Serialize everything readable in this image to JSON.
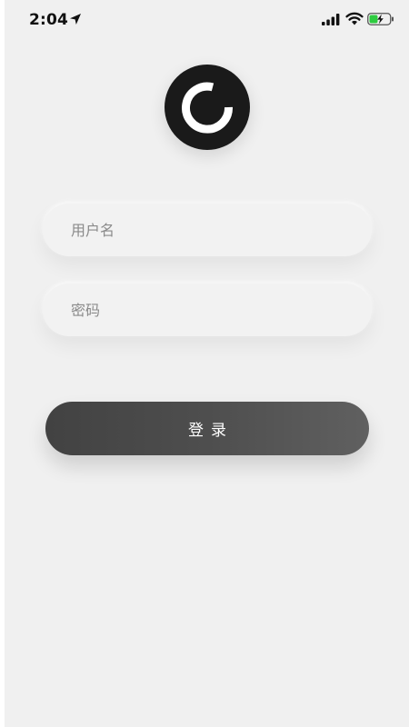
{
  "status_bar": {
    "time": "2:04",
    "icons": [
      "location-arrow-icon",
      "signal-icon",
      "wifi-icon",
      "battery-charging-icon"
    ],
    "battery_color": "#2ecc40"
  },
  "logo": {
    "icon": "logo-ring-icon",
    "background_color": "#1a1a1a",
    "ring_color": "#ffffff"
  },
  "form": {
    "username_placeholder": "用户名",
    "username_value": "",
    "password_placeholder": "密码",
    "password_value": ""
  },
  "login_button": {
    "label": "登录",
    "gradient_start": "#424242",
    "gradient_end": "#606060"
  },
  "background_color": "#f0f0f0"
}
